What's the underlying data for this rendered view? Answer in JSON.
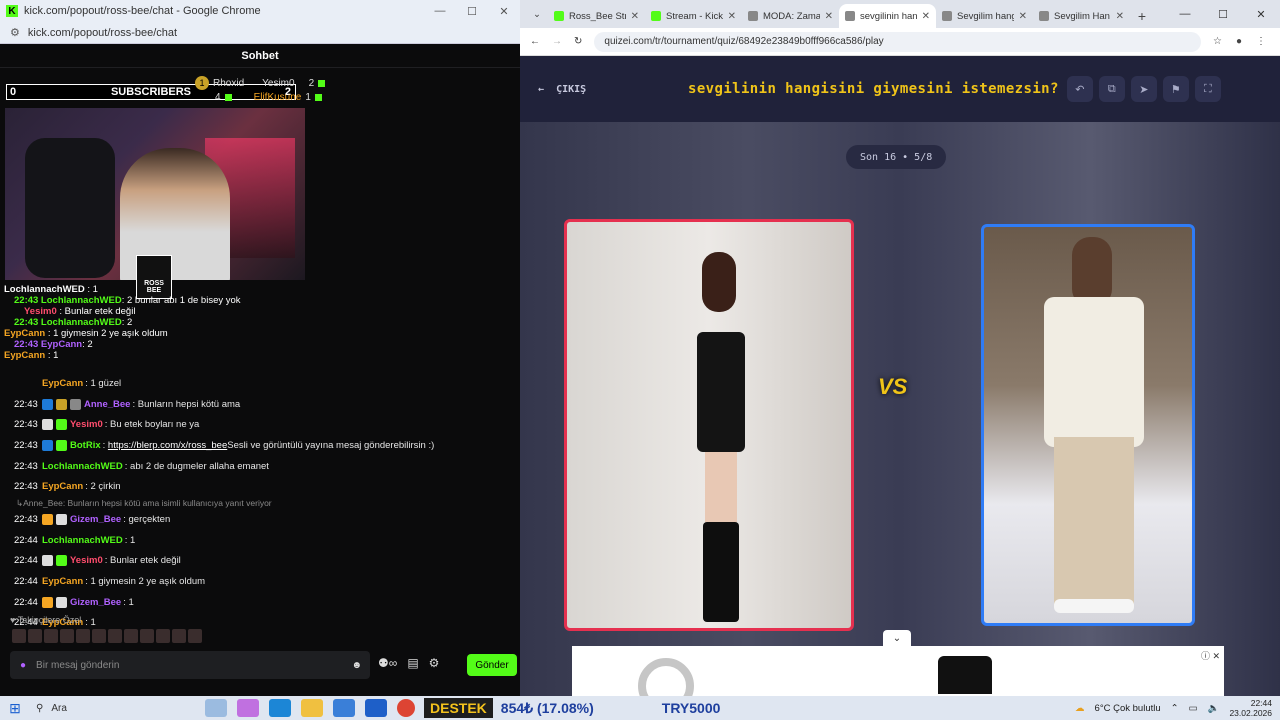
{
  "left_window": {
    "title": "kick.com/popout/ross-bee/chat - Google Chrome",
    "url": "kick.com/popout/ross-bee/chat",
    "chat_header": "Sohbet",
    "overlay": {
      "left_count": "0",
      "subscribers_label": "SUBSCRIBERS",
      "right_count": "2",
      "leaderboard": [
        {
          "name": "Rhoxid",
          "count": "1"
        },
        {
          "name": "Yesim0",
          "count": "2"
        },
        {
          "name": "4",
          "count": ""
        },
        {
          "name": "ElifKusune",
          "count": "1"
        }
      ],
      "clap_text": "ROSS BEE",
      "overlay_messages": [
        {
          "nick": "LochlannachWED",
          "text": " : 1"
        },
        {
          "nick": "22:43 LochlannachWED",
          "text": ": 2 bunlar abı 1 de bisey yok"
        },
        {
          "nick": "Yesim0",
          "text": " : Bunlar etek değil"
        },
        {
          "nick": "22:43 LochlannachWED",
          "text": ": 2"
        },
        {
          "nick": "EypCann",
          "text": " : 1 giymesin 2 ye aşık oldum"
        },
        {
          "nick": "22:43 EypCann",
          "text": ": 2"
        },
        {
          "nick": "EypCann",
          "text": " : 1"
        }
      ]
    },
    "messages": [
      {
        "time": "",
        "nick": "EypCann",
        "nick_color": "#f5a623",
        "text": ": 1 güzel",
        "badges": []
      },
      {
        "time": "22:43",
        "nick": "Anne_Bee",
        "nick_color": "#b061ff",
        "text": ": Bunların hepsi kötü ama",
        "badges": [
          "#1e7bd8",
          "#c9a227",
          "#888888"
        ]
      },
      {
        "time": "22:43",
        "nick": "Yesim0",
        "nick_color": "#ff4d6d",
        "text": ": Bu etek boyları ne ya",
        "badges": [
          "#dddddd",
          "#53fc18"
        ]
      },
      {
        "time": "22:43",
        "nick": "BotRix",
        "nick_color": "#53fc18",
        "link": "https://blerp.com/x/ross_bee",
        "text": " Sesli ve görüntülü yayına mesaj gönderebilirsin :)",
        "badges": [
          "#1e7bd8",
          "#53fc18"
        ]
      },
      {
        "time": "22:43",
        "nick": "LochlannachWED",
        "nick_color": "#53fc18",
        "text": ": abı 2 de dugmeler allaha emanet",
        "badges": []
      },
      {
        "time": "22:43",
        "nick": "EypCann",
        "nick_color": "#f5a623",
        "text": ": 2 çirkin",
        "badges": []
      },
      {
        "reply": "Anne_Bee: Bunların hepsi kötü ama isimli kullanıcıya yanıt veriyor"
      },
      {
        "time": "22:43",
        "nick": "Gizem_Bee",
        "nick_color": "#b061ff",
        "text": ": gerçekten",
        "badges": [
          "#f5a623",
          "#dddddd"
        ]
      },
      {
        "time": "22:44",
        "nick": "LochlannachWED",
        "nick_color": "#53fc18",
        "text": ": 1",
        "badges": []
      },
      {
        "time": "22:44",
        "nick": "Yesim0",
        "nick_color": "#ff4d6d",
        "text": ": Bunlar etek değil",
        "badges": [
          "#dddddd",
          "#53fc18"
        ]
      },
      {
        "time": "22:44",
        "nick": "EypCann",
        "nick_color": "#f5a623",
        "text": ": 1 giymesin 2 ye aşık oldum",
        "badges": []
      },
      {
        "time": "22:44",
        "nick": "Gizem_Bee",
        "nick_color": "#b061ff",
        "text": ": 1",
        "badges": [
          "#f5a623",
          "#dddddd"
        ]
      },
      {
        "time": "22:44",
        "nick": "EypCann",
        "nick_color": "#f5a623",
        "text": ": 1",
        "badges": []
      }
    ],
    "followers_only": "Takipçilere Özel",
    "input_placeholder": "Bir mesaj gönderin",
    "send_label": "Gönder"
  },
  "right_window": {
    "tabs": [
      {
        "label": "Ross_Bee Stre",
        "color": "#53fc18",
        "active": false
      },
      {
        "label": "Stream - Kick",
        "color": "#53fc18",
        "active": false
      },
      {
        "label": "MODA: Zaman",
        "color": "#888888",
        "active": false
      },
      {
        "label": "sevgilinin han",
        "color": "#888888",
        "active": true
      },
      {
        "label": "Sevgilim hang",
        "color": "#888888",
        "active": false
      },
      {
        "label": "Sevgilim Han",
        "color": "#888888",
        "active": false
      }
    ],
    "url": "quizei.com/tr/tournament/quiz/68492e23849b0fff966ca586/play",
    "exit_label": "ÇIKIŞ",
    "quiz_title": "sevgilinin hangisini giymesini istemezsin?",
    "round": "Son 16 • 5/8",
    "vs": "VS"
  },
  "taskbar": {
    "search_label": "Ara",
    "ticker_label": "DESTEK",
    "ticker_value": "854₺ (17.08%)",
    "ticker_goal": "TRY5000",
    "weather": "6°C  Çok bulutlu",
    "time": "22:44",
    "date": "23.02.2026"
  }
}
